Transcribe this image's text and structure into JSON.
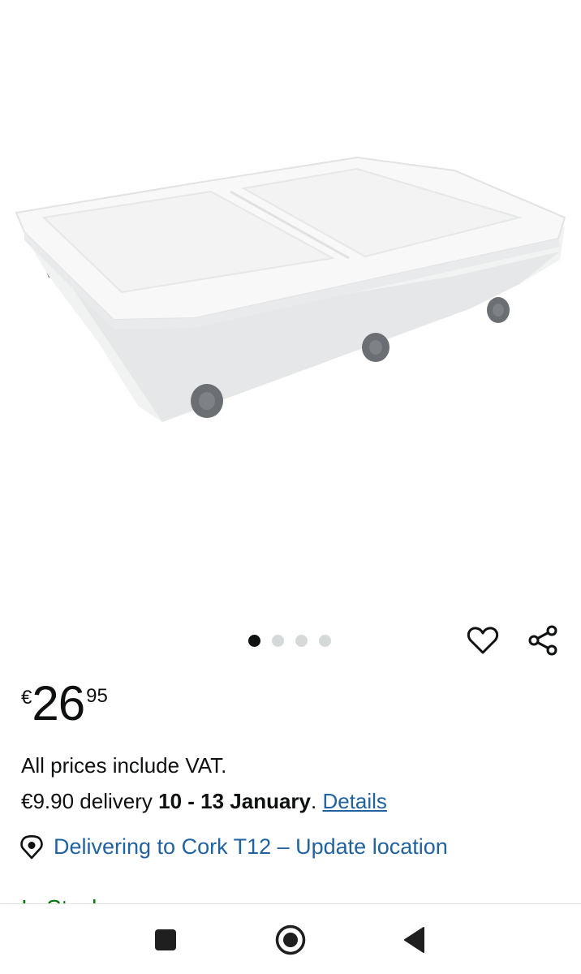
{
  "product": {
    "image_alt": "White under-bed storage box with lid, grey handles and wheels",
    "image_count": 4,
    "active_image_index": 0
  },
  "actions": {
    "wishlist_icon": "heart-outline-icon",
    "share_icon": "share-icon"
  },
  "price": {
    "currency": "€",
    "whole": "26",
    "fraction": "95"
  },
  "vat_note": "All prices include VAT.",
  "delivery": {
    "prefix": "€9.90 delivery ",
    "dates": "10 - 13 January",
    "suffix": ". ",
    "details_link": "Details"
  },
  "location": {
    "icon": "location-pin-icon",
    "text": "Delivering to Cork T12 – Update location"
  },
  "stock": {
    "text": "In Stock"
  },
  "system_nav": {
    "recents_icon": "square-icon",
    "home_icon": "circle-home-icon",
    "back_icon": "triangle-back-icon"
  },
  "colors": {
    "link": "#2162a1",
    "text": "#0f1111",
    "dot_active": "#0f1111",
    "dot_inactive": "#d5d9d9",
    "stock": "#007600"
  }
}
